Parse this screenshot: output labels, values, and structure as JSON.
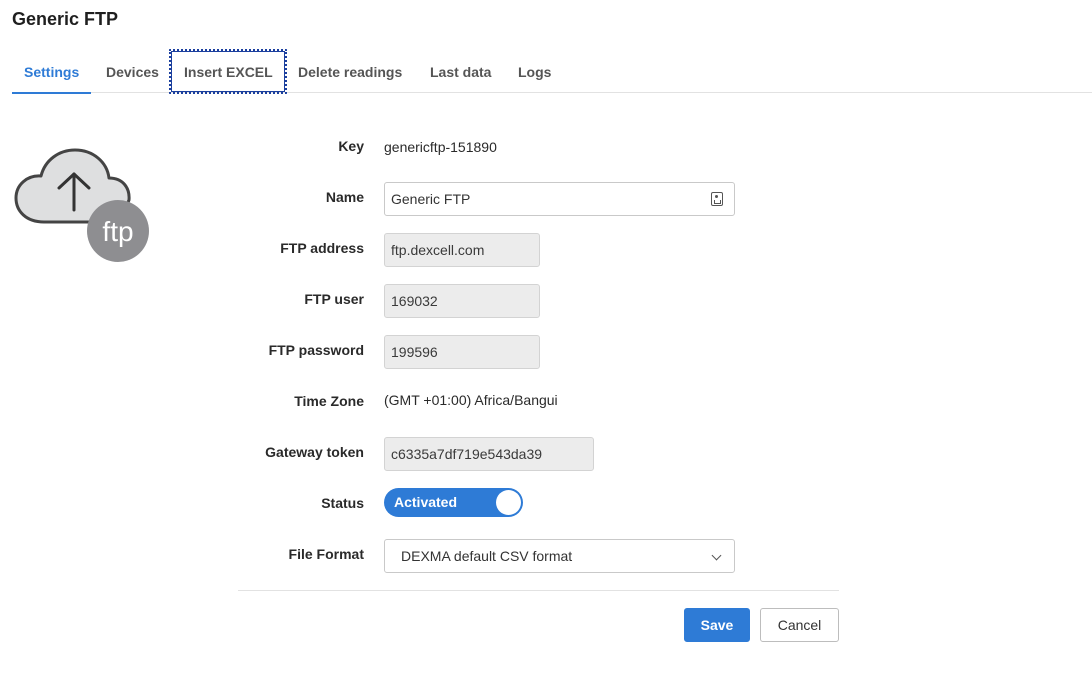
{
  "page": {
    "title": "Generic FTP"
  },
  "tabs": [
    {
      "label": "Settings",
      "active": true
    },
    {
      "label": "Devices"
    },
    {
      "label": "Insert EXCEL",
      "focused": true
    },
    {
      "label": "Delete readings"
    },
    {
      "label": "Last data"
    },
    {
      "label": "Logs"
    }
  ],
  "logo": {
    "badge_text": "ftp",
    "icon": "cloud-upload-icon"
  },
  "form": {
    "key": {
      "label": "Key",
      "value": "genericftp-151890"
    },
    "name": {
      "label": "Name",
      "value": "Generic FTP"
    },
    "ftp_address": {
      "label": "FTP address",
      "value": "ftp.dexcell.com"
    },
    "ftp_user": {
      "label": "FTP user",
      "value": "169032"
    },
    "ftp_password": {
      "label": "FTP password",
      "value": "199596"
    },
    "time_zone": {
      "label": "Time Zone",
      "value": "(GMT +01:00) Africa/Bangui"
    },
    "gateway_token": {
      "label": "Gateway token",
      "value": "c6335a7df719e543da39"
    },
    "status": {
      "label": "Status",
      "value": "Activated",
      "on": true
    },
    "file_format": {
      "label": "File Format",
      "value": "DEXMA default CSV format"
    }
  },
  "actions": {
    "save": "Save",
    "cancel": "Cancel"
  },
  "colors": {
    "accent": "#2e7bd6",
    "focus": "#1b3f9e"
  }
}
